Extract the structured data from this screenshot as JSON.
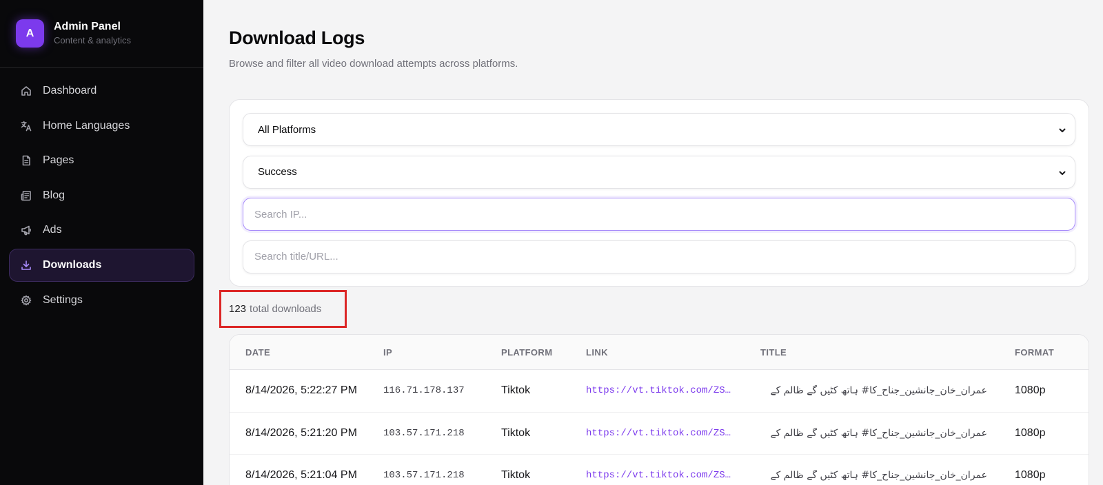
{
  "sidebar": {
    "brand": {
      "logo_letter": "A",
      "title": "Admin Panel",
      "subtitle": "Content & analytics",
      "accent": "#7c3aed"
    },
    "items": [
      {
        "label": "Dashboard",
        "icon": "home-icon"
      },
      {
        "label": "Home Languages",
        "icon": "translate-icon"
      },
      {
        "label": "Pages",
        "icon": "document-icon"
      },
      {
        "label": "Blog",
        "icon": "newspaper-icon"
      },
      {
        "label": "Ads",
        "icon": "megaphone-icon"
      },
      {
        "label": "Downloads",
        "icon": "download-icon",
        "active": true
      },
      {
        "label": "Settings",
        "icon": "gear-icon"
      }
    ]
  },
  "header": {
    "title": "Download Logs",
    "subtitle": "Browse and filter all video download attempts across platforms."
  },
  "filters": {
    "platform": {
      "selected": "All Platforms"
    },
    "status": {
      "selected": "Success"
    },
    "ip_search": {
      "value": "",
      "placeholder": "Search IP..."
    },
    "title_search": {
      "value": "",
      "placeholder": "Search title/URL..."
    }
  },
  "summary": {
    "count": "123",
    "label": "total downloads"
  },
  "table": {
    "columns": [
      "DATE",
      "IP",
      "PLATFORM",
      "LINK",
      "TITLE",
      "FORMAT"
    ],
    "rows": [
      {
        "date": "8/14/2026, 5:22:27 PM",
        "ip": "116.71.178.137",
        "platform": "Tiktok",
        "link": "https://vt.tiktok.com/ZS…",
        "title": "عمران_خان_جانشین_جناح_کا# ہاتھ کٹیں گے ظالم کے",
        "format": "1080p"
      },
      {
        "date": "8/14/2026, 5:21:20 PM",
        "ip": "103.57.171.218",
        "platform": "Tiktok",
        "link": "https://vt.tiktok.com/ZS…",
        "title": "عمران_خان_جانشین_جناح_کا# ہاتھ کٹیں گے ظالم کے",
        "format": "1080p"
      },
      {
        "date": "8/14/2026, 5:21:04 PM",
        "ip": "103.57.171.218",
        "platform": "Tiktok",
        "link": "https://vt.tiktok.com/ZS…",
        "title": "عمران_خان_جانشین_جناح_کا# ہاتھ کٹیں گے ظالم کے",
        "format": "1080p"
      }
    ]
  }
}
